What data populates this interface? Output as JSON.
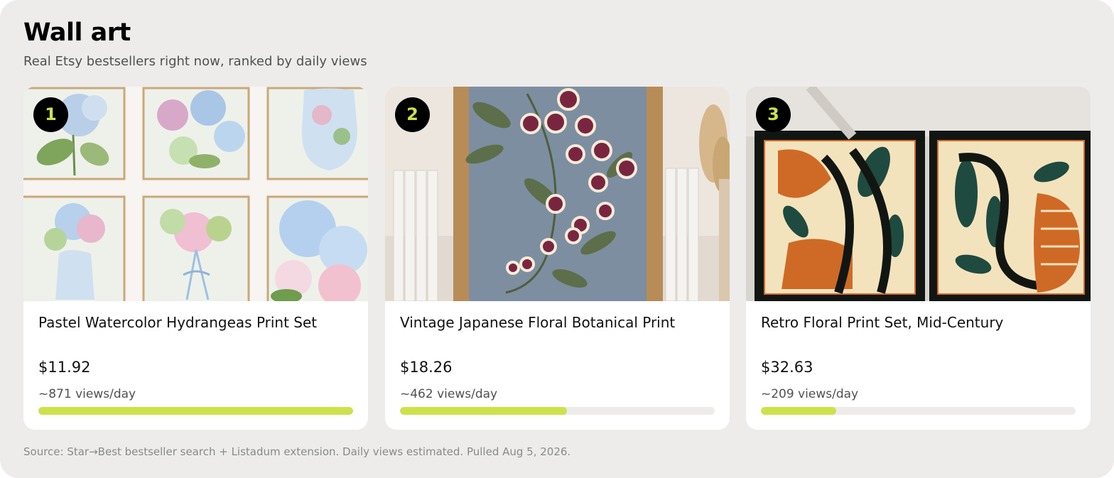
{
  "header": {
    "title": "Wall art",
    "subtitle": "Real Etsy bestsellers right now, ranked by daily views"
  },
  "products": [
    {
      "rank": "1",
      "name": "Pastel Watercolor Hydrangeas Print Set",
      "price": "$11.92",
      "views_label": "~871 views/day",
      "views_per_day": 871,
      "image_icon": "watercolor-hydrangea-gallery-image"
    },
    {
      "rank": "2",
      "name": "Vintage Japanese Floral Botanical Print",
      "price": "$18.26",
      "views_label": "~462 views/day",
      "views_per_day": 462,
      "image_icon": "japanese-floral-print-image"
    },
    {
      "rank": "3",
      "name": "Retro Floral Print Set, Mid-Century",
      "price": "$32.63",
      "views_label": "~209 views/day",
      "views_per_day": 209,
      "image_icon": "retro-floral-prints-image"
    }
  ],
  "footer": {
    "source": "Source: Star→Best bestseller search + Listadum extension. Daily views estimated. Pulled Aug 5, 2026."
  },
  "colors": {
    "accent": "#cde14a",
    "background": "#edecea",
    "rank_badge": "#000000"
  }
}
